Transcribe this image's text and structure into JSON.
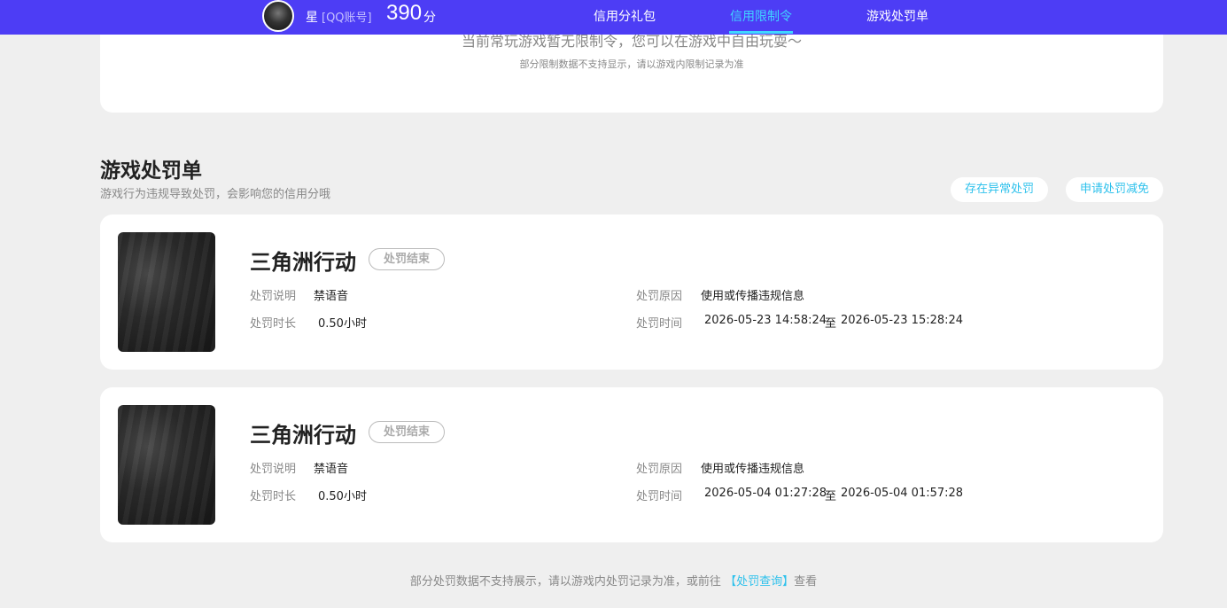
{
  "nav": {
    "user_name": "星",
    "account_type": "[QQ账号]",
    "score": "390",
    "score_unit": "分",
    "tabs": [
      {
        "label": "信用分礼包",
        "active": false
      },
      {
        "label": "信用限制令",
        "active": true
      },
      {
        "label": "游戏处罚单",
        "active": false
      }
    ],
    "colors": {
      "bar": "#4d3df5",
      "active_tab": "#3fd6ff"
    }
  },
  "restriction_card": {
    "partial_text": "当前常玩游戏暂无限制令，您可以在游戏中自由玩耍～",
    "note": "部分限制数据不支持显示，请以游戏内限制记录为准"
  },
  "penalty_section": {
    "title": "游戏处罚单",
    "subtitle": "游戏行为违规导致处罚，会影响您的信用分哦",
    "buttons": {
      "appeal_abnormal": "存在异常处罚",
      "apply_reduction": "申请处罚减免"
    },
    "labels": {
      "desc": "处罚说明",
      "duration": "处罚时长",
      "reason": "处罚原因",
      "time": "处罚时间",
      "to": "至"
    },
    "items": [
      {
        "game": "三角洲行动",
        "status": "处罚结束",
        "desc": "禁语音",
        "duration": "0.50小时",
        "reason": "使用或传播违规信息",
        "start": "2026-05-23 14:58:24",
        "end": "2026-05-23 15:28:24"
      },
      {
        "game": "三角洲行动",
        "status": "处罚结束",
        "desc": "禁语音",
        "duration": "0.50小时",
        "reason": "使用或传播违规信息",
        "start": "2026-05-04 01:27:28",
        "end": "2026-05-04 01:57:28"
      }
    ]
  },
  "footer": {
    "text_before": "部分处罚数据不支持展示，请以游戏内处罚记录为准，或前往",
    "link": "【处罚查询】",
    "text_after": "查看"
  }
}
